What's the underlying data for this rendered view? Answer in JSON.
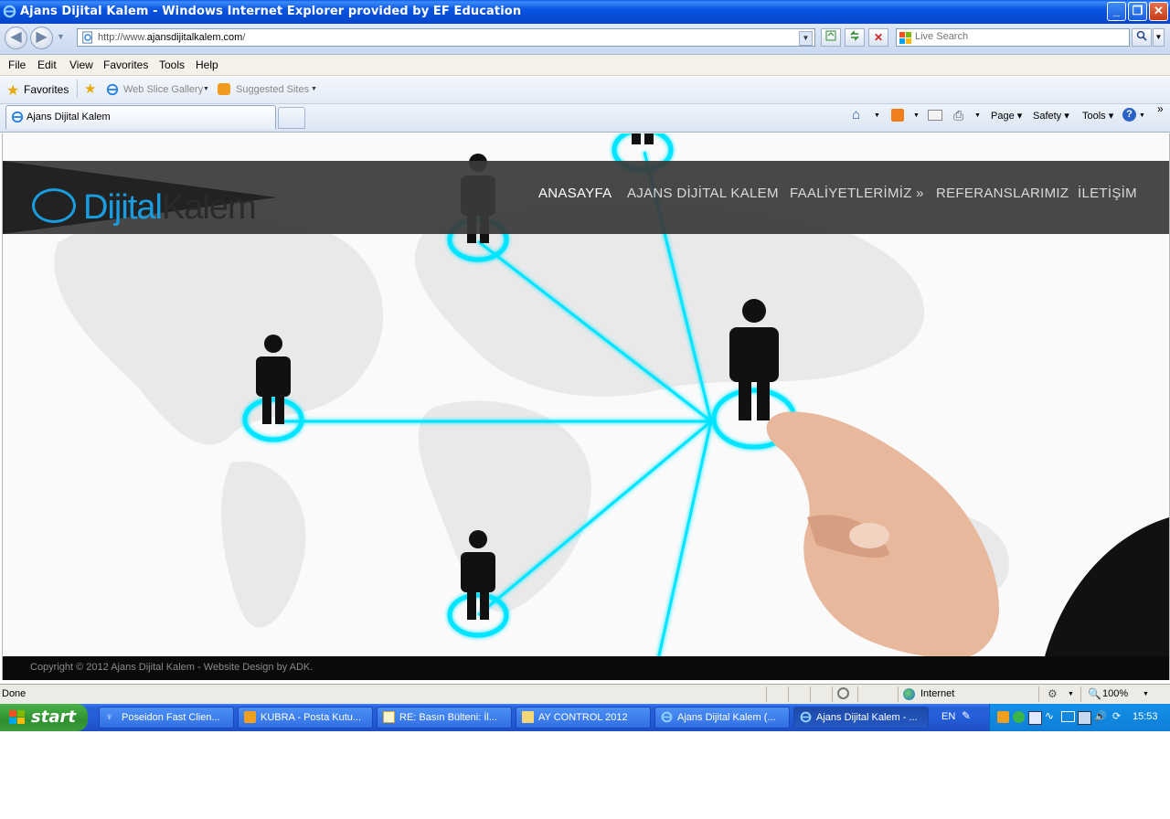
{
  "window": {
    "title": "Ajans Dijital Kalem - Windows Internet Explorer provided by EF Education",
    "minimize_label": "_",
    "restore_label": "❐",
    "close_label": "✕"
  },
  "address_bar": {
    "url_prefix": "http://www.",
    "url_domain": "ajansdijitalkalem.com",
    "url_suffix": "/"
  },
  "search": {
    "placeholder": "Live Search"
  },
  "menu": {
    "items": [
      "File",
      "Edit",
      "View",
      "Favorites",
      "Tools",
      "Help"
    ]
  },
  "favorites_bar": {
    "favorites_label": "Favorites",
    "web_slice_label": "Web Slice Gallery",
    "suggested_label": "Suggested Sites"
  },
  "tabs": {
    "active_label": "Ajans Dijital Kalem"
  },
  "command_bar": {
    "page_label": "Page",
    "safety_label": "Safety",
    "tools_label": "Tools"
  },
  "website": {
    "logo_part1": "Dijital",
    "logo_part2": "Kalem",
    "nav": [
      "ANASAYFA",
      "AJANS DİJİTAL KALEM",
      "FAALİYETLERİMİZ »",
      "REFERANSLARIMIZ",
      "İLETİŞİM"
    ],
    "footer": "Copyright © 2012 Ajans Dijital Kalem - Website Design by ADK.",
    "accent_color": "#00e5ff"
  },
  "status_bar": {
    "status": "Done",
    "zone": "Internet",
    "zoom": "100%"
  },
  "taskbar": {
    "start_label": "start",
    "tasks": [
      "Poseidon Fast Clien...",
      "KUBRA - Posta Kutu...",
      "RE: Basın Bülteni: İl...",
      "AY CONTROL 2012",
      "Ajans Dijital Kalem (...",
      "Ajans Dijital Kalem - ..."
    ],
    "language": "EN",
    "clock": "15:53"
  }
}
